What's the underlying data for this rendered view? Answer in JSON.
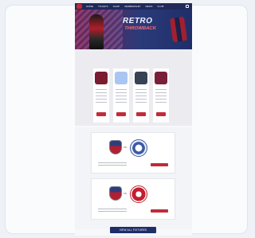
{
  "header": {
    "nav_items": [
      "HOME",
      "TICKETS",
      "SHOP",
      "MEMBERSHIP",
      "NEWS",
      "CLUB"
    ]
  },
  "hero": {
    "title": "RETRO",
    "subtitle": "THROWBACK"
  },
  "products": {
    "items": [
      {
        "name": "",
        "price": "",
        "color": "#7b1b2f"
      },
      {
        "name": "",
        "price": "",
        "color": "#a9c6f2"
      },
      {
        "name": "",
        "price": "",
        "color": "#384255"
      },
      {
        "name": "",
        "price": "",
        "color": "#7a1f3a"
      }
    ]
  },
  "matches": {
    "cards": [
      {
        "home": "",
        "away": "",
        "away_style": "blue"
      },
      {
        "home": "",
        "away": "",
        "away_style": "red"
      }
    ]
  },
  "footer": {
    "button_label": "VIEW ALL FIXTURES"
  }
}
